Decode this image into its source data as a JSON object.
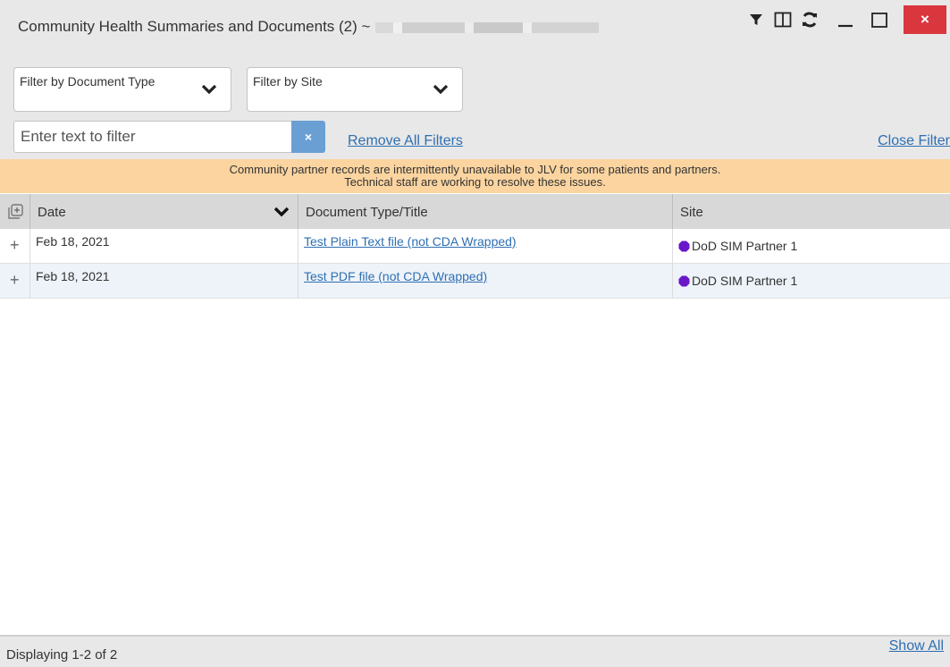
{
  "window": {
    "title": "Community Health Summaries and Documents (2) ~",
    "icons": [
      "filter-icon",
      "columns-icon",
      "refresh-icon",
      "minimize-icon",
      "maximize-icon",
      "close-icon"
    ],
    "close_symbol": "×"
  },
  "filters": {
    "document_type_label": "Filter by Document Type",
    "site_label": "Filter by Site",
    "text_placeholder": "Enter text to filter",
    "clear_symbol": "×",
    "remove_all_label": "Remove All Filters",
    "close_filter_label": "Close Filter"
  },
  "banner": {
    "line1": "Community partner records are intermittently unavailable to JLV for some patients and partners.",
    "line2": "Technical staff are working to resolve these issues.",
    "color": "#fbd4a0"
  },
  "table": {
    "columns": [
      "Date",
      "Document Type/Title",
      "Site"
    ],
    "rows": [
      {
        "expand": "+",
        "date": "Feb 18, 2021",
        "title": "Test Plain Text file (not CDA Wrapped)",
        "site": "DoD SIM Partner 1",
        "site_color": "#6a16c9"
      },
      {
        "expand": "+",
        "date": "Feb 18, 2021",
        "title": "Test PDF file (not CDA Wrapped)",
        "site": "DoD SIM Partner 1",
        "site_color": "#6a16c9"
      }
    ]
  },
  "footer": {
    "status": "Displaying 1-2 of 2",
    "show_all_label": "Show All"
  },
  "colors": {
    "accent_link": "#2f6fb2",
    "close_button": "#d9363e",
    "clear_button": "#6a9fd4",
    "row_alt": "#edf3f9"
  }
}
